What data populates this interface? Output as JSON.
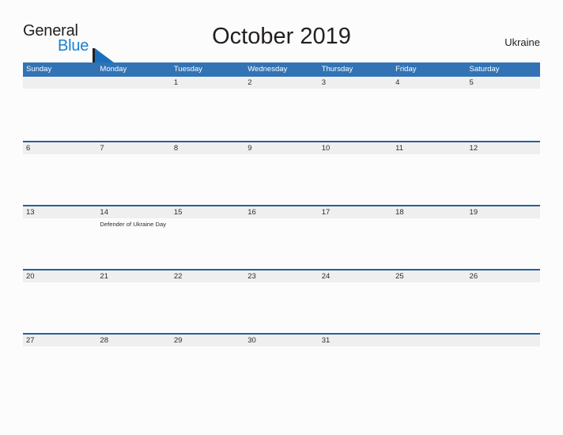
{
  "brand": {
    "name_part1": "General",
    "name_part2": "Blue",
    "flag_icon": "flag-triangle-icon",
    "color_dark": "#231f20",
    "color_blue": "#1b7fd0"
  },
  "header": {
    "title": "October 2019",
    "country": "Ukraine"
  },
  "theme": {
    "header_blue": "#3173b5",
    "row_rule_blue": "#2a6099",
    "date_band_gray": "#efefef",
    "page_background": "#fcfcfc",
    "text_color": "#2d2d2d"
  },
  "calendar": {
    "month": "October",
    "year": "2019",
    "weekday_headers": [
      "Sunday",
      "Monday",
      "Tuesday",
      "Wednesday",
      "Thursday",
      "Friday",
      "Saturday"
    ],
    "weeks": [
      [
        {
          "date": "",
          "events": ""
        },
        {
          "date": "",
          "events": ""
        },
        {
          "date": "1",
          "events": ""
        },
        {
          "date": "2",
          "events": ""
        },
        {
          "date": "3",
          "events": ""
        },
        {
          "date": "4",
          "events": ""
        },
        {
          "date": "5",
          "events": ""
        }
      ],
      [
        {
          "date": "6",
          "events": ""
        },
        {
          "date": "7",
          "events": ""
        },
        {
          "date": "8",
          "events": ""
        },
        {
          "date": "9",
          "events": ""
        },
        {
          "date": "10",
          "events": ""
        },
        {
          "date": "11",
          "events": ""
        },
        {
          "date": "12",
          "events": ""
        }
      ],
      [
        {
          "date": "13",
          "events": ""
        },
        {
          "date": "14",
          "events": "Defender of Ukraine Day"
        },
        {
          "date": "15",
          "events": ""
        },
        {
          "date": "16",
          "events": ""
        },
        {
          "date": "17",
          "events": ""
        },
        {
          "date": "18",
          "events": ""
        },
        {
          "date": "19",
          "events": ""
        }
      ],
      [
        {
          "date": "20",
          "events": ""
        },
        {
          "date": "21",
          "events": ""
        },
        {
          "date": "22",
          "events": ""
        },
        {
          "date": "23",
          "events": ""
        },
        {
          "date": "24",
          "events": ""
        },
        {
          "date": "25",
          "events": ""
        },
        {
          "date": "26",
          "events": ""
        }
      ],
      [
        {
          "date": "27",
          "events": ""
        },
        {
          "date": "28",
          "events": ""
        },
        {
          "date": "29",
          "events": ""
        },
        {
          "date": "30",
          "events": ""
        },
        {
          "date": "31",
          "events": ""
        },
        {
          "date": "",
          "events": ""
        },
        {
          "date": "",
          "events": ""
        }
      ]
    ]
  }
}
